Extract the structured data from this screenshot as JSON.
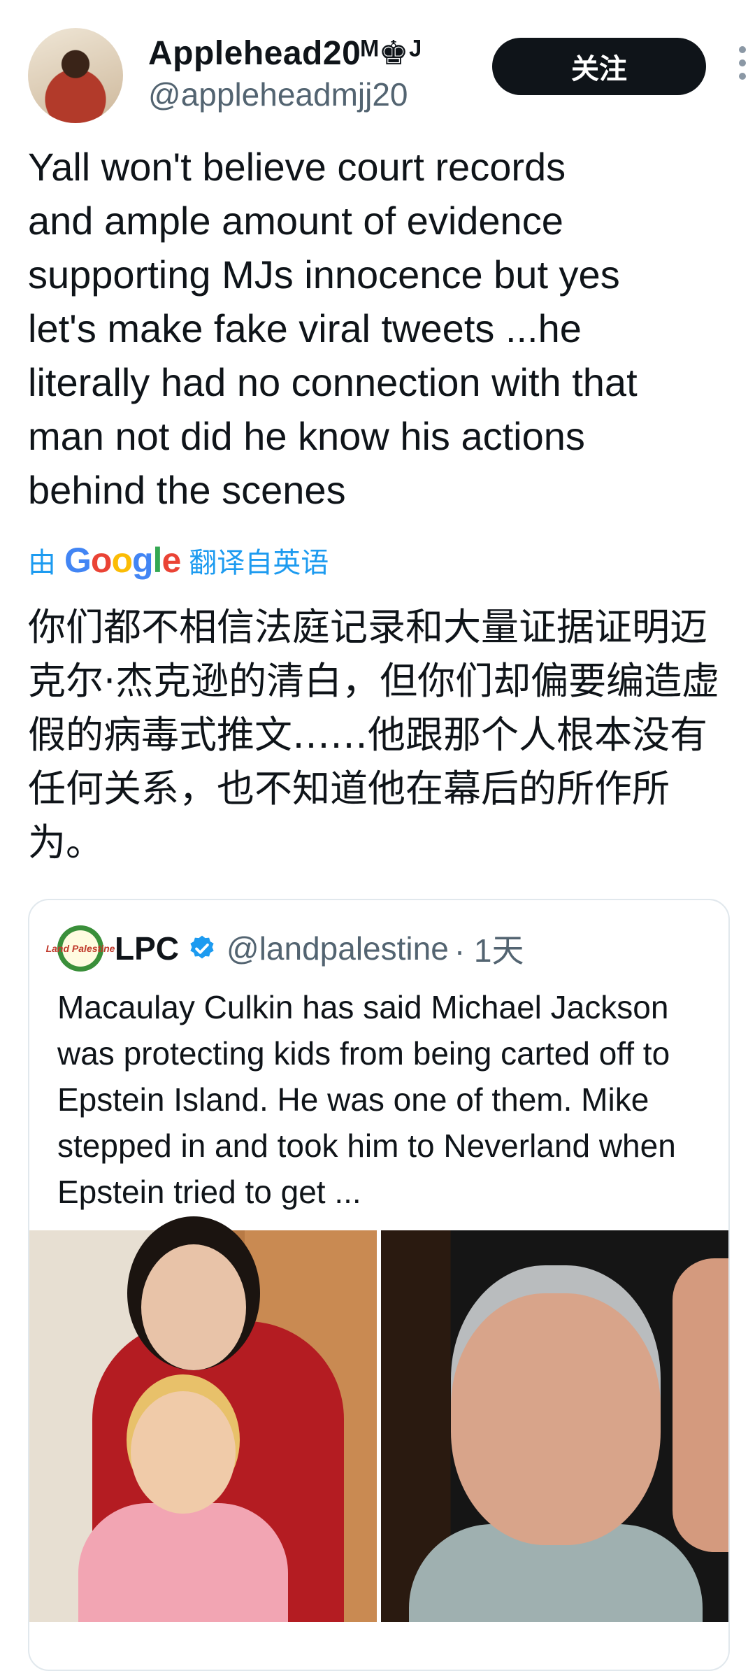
{
  "author": {
    "display_name": "Applehead20ᴹ♚ᴶ",
    "handle": "@appleheadmjj20"
  },
  "follow_button_label": "关注",
  "tweet_text": "Yall won't believe court records\nand ample amount of evidence\nsupporting MJs innocence but yes\nlet's make fake viral tweets ...he\nliterally had no connection with that\nman not did he know his actions\nbehind the scenes",
  "translation": {
    "prefix": "由",
    "provider": "Google",
    "suffix": "翻译自英语",
    "text": "你们都不相信法庭记录和大量证据证明迈克尔·杰克逊的清白，但你们却偏要编造虚假的病毒式推文……他跟那个人根本没有任何关系，也不知道他在幕后的所作所为。"
  },
  "quoted_tweet": {
    "avatar_text": "Land Palestine",
    "name": "LPC",
    "handle": "@landpalestine",
    "time": "· 1天",
    "text": "Macaulay Culkin has said Michael Jackson was protecting kids from being carted off to Epstein Island. He was one of them. Mike stepped in and took him to Neverland when Epstein tried to get ...",
    "verified_color": "#1d9bf0"
  },
  "colors": {
    "link_blue": "#1d9bf0",
    "secondary_text": "#536471",
    "button_bg": "#0f1419"
  }
}
